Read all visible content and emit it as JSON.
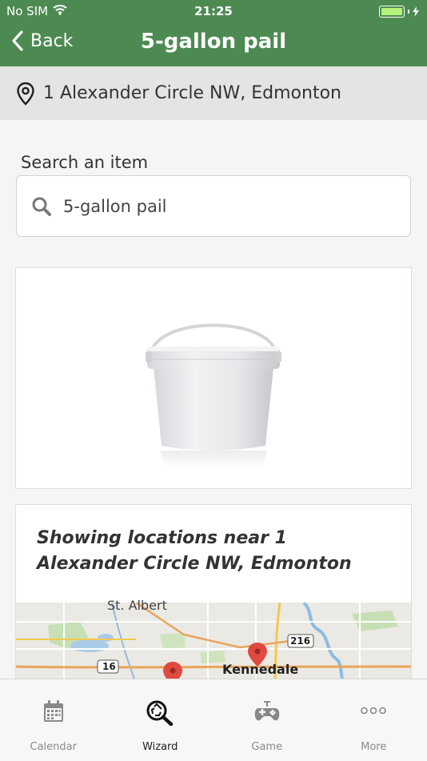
{
  "status": {
    "carrier": "No SIM",
    "time": "21:25",
    "battery_level": 1.0
  },
  "nav": {
    "back_label": "Back",
    "title": "5-gallon pail"
  },
  "location": {
    "address": "1 Alexander Circle NW, Edmonton"
  },
  "search": {
    "label": "Search an item",
    "value": "5-gallon pail"
  },
  "result": {
    "image_alt": "white plastic pail with handle",
    "showing_text": "Showing locations near 1 Alexander Circle NW, Edmonton"
  },
  "map": {
    "places": [
      "St. Albert",
      "Kennedale"
    ],
    "routes": [
      "216",
      "16"
    ]
  },
  "tabbar": {
    "tabs": [
      {
        "label": "Calendar",
        "icon": "calendar-icon",
        "active": false
      },
      {
        "label": "Wizard",
        "icon": "wizard-icon",
        "active": true
      },
      {
        "label": "Game",
        "icon": "gamepad-icon",
        "active": false
      },
      {
        "label": "More",
        "icon": "more-icon",
        "active": false
      }
    ]
  },
  "colors": {
    "header": "#4d8a52",
    "pin": "#e0493f"
  }
}
